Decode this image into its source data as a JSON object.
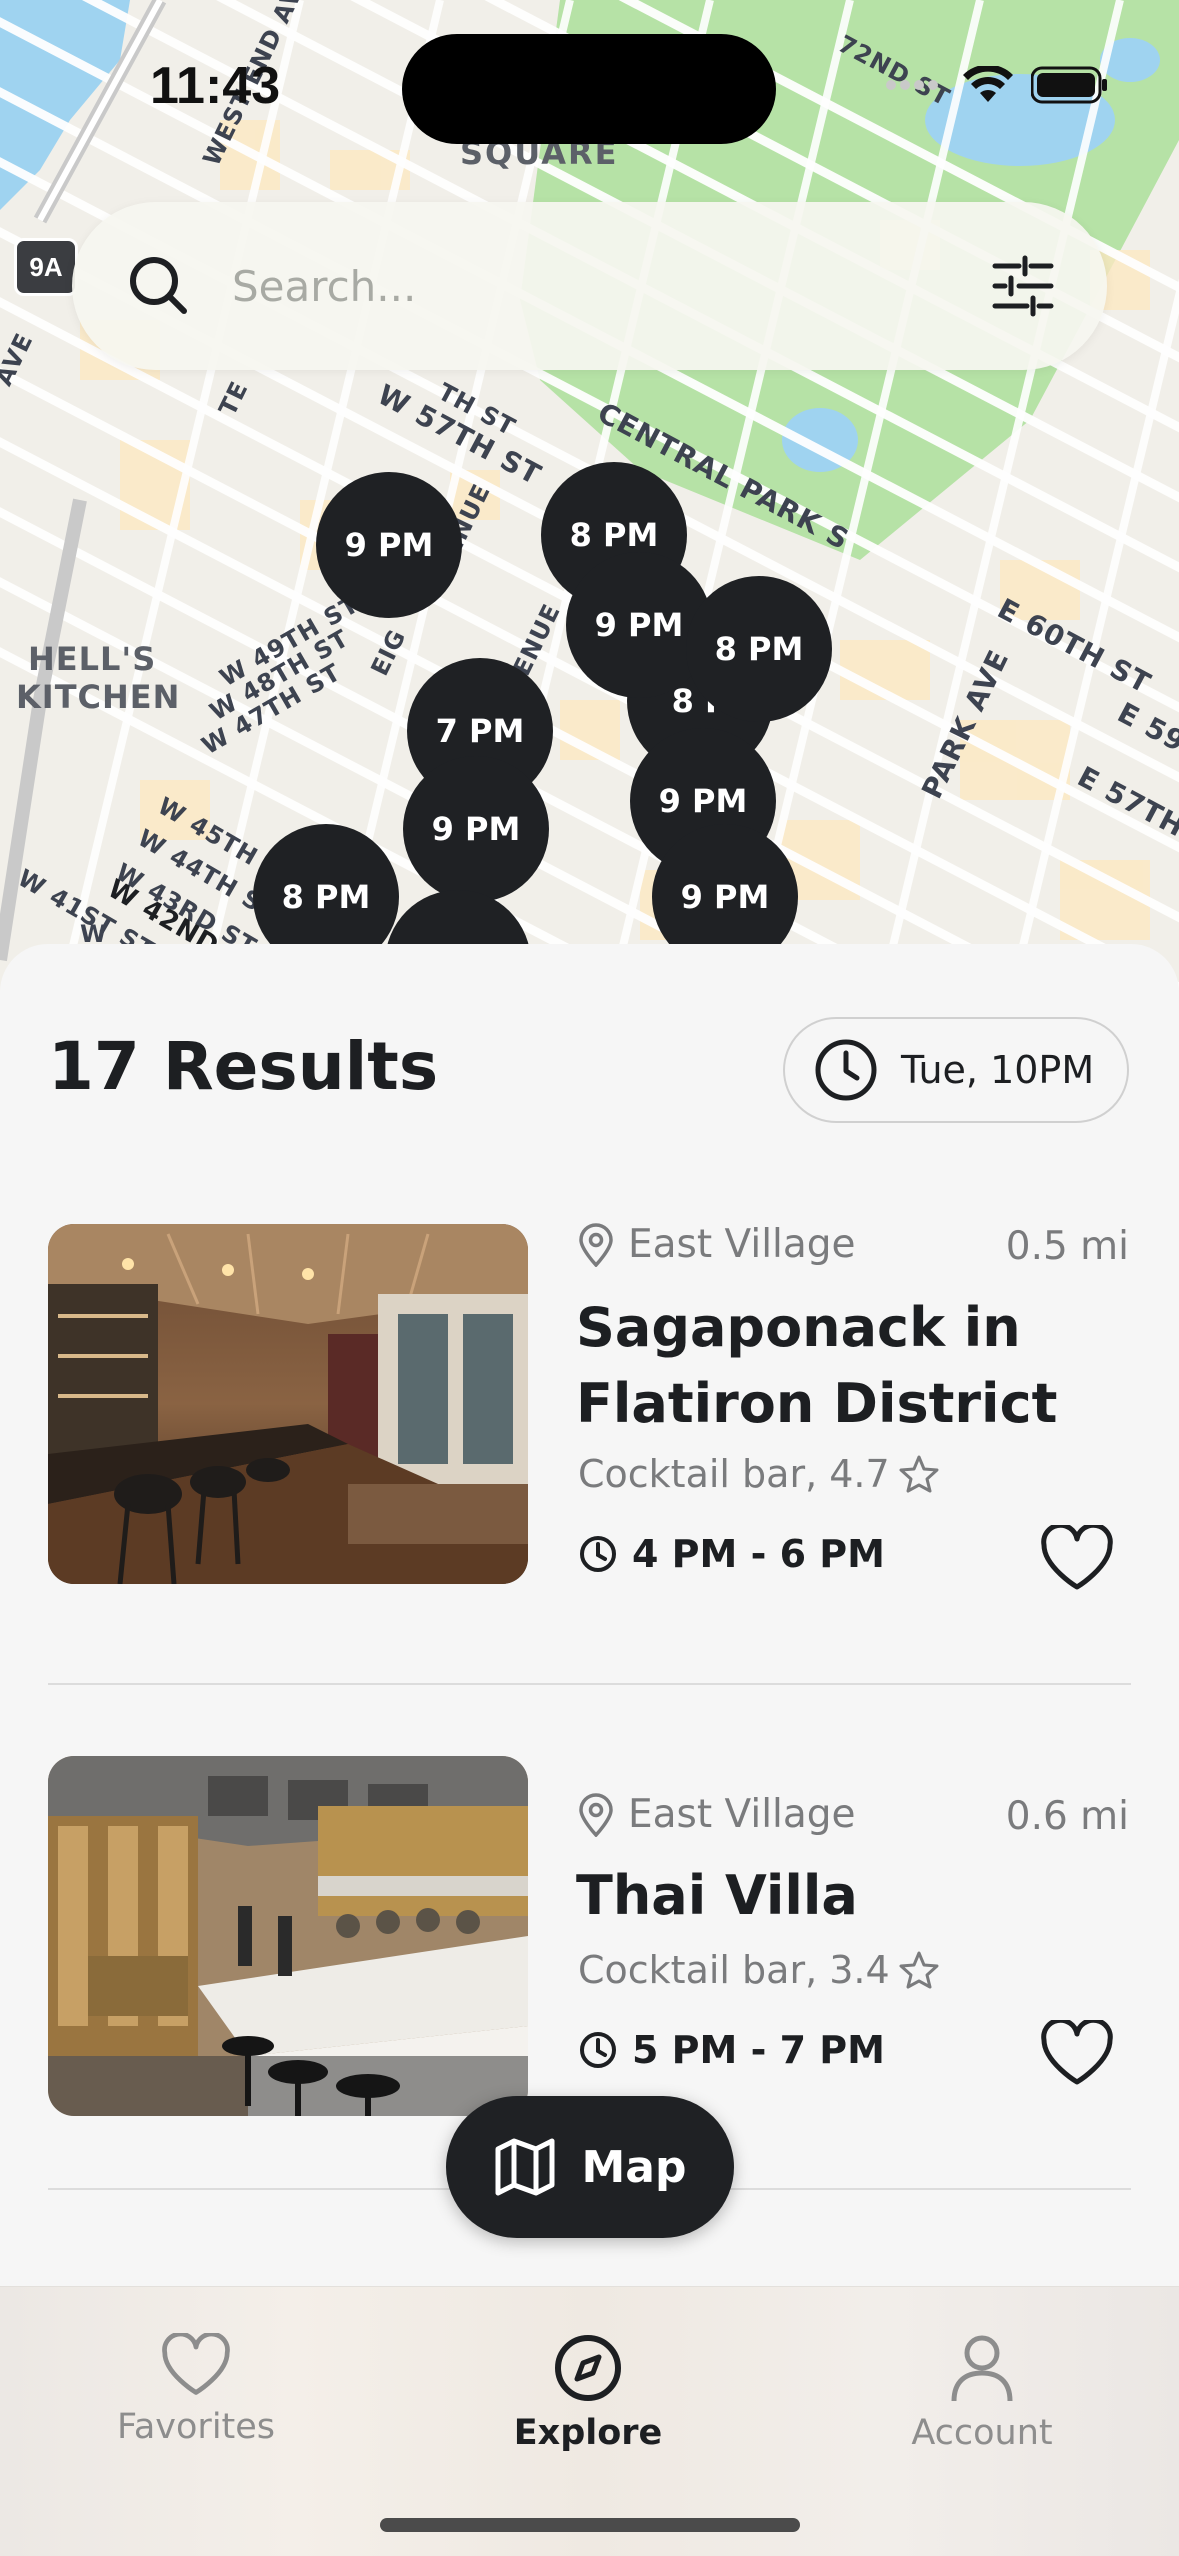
{
  "status_bar": {
    "time": "11:43"
  },
  "map": {
    "labels": {
      "square": "SQUARE",
      "hells_kitchen_1": "HELL'S",
      "hells_kitchen_2": "KITCHEN",
      "route": "9A"
    },
    "streets": {
      "w57": "W 57TH ST",
      "central_park_s": "CENTRAL PARK S",
      "e60": "E 60TH ST",
      "e59": "E 59",
      "e57": "E 57TH",
      "park_ave": "PARK AVE",
      "w49": "W 49TH ST",
      "w48": "W 48TH ST",
      "w47": "W 47TH ST",
      "w45": "W 45TH ST",
      "w44": "W 44TH ST",
      "w43": "W 43RD ST",
      "w42": "W 42ND ST",
      "w41": "W 41ST ST",
      "w_end": "W",
      "west_end_av": "WEST END AV",
      "seventy_second": "72ND ST",
      "ave_left": "AVE",
      "eighth_ave": "EIG",
      "enue_1": "ENUE",
      "enue_2": "ENUE",
      "te": "TE",
      "ith_st": "TH ST"
    },
    "pins": [
      {
        "label": "9 PM"
      },
      {
        "label": "8 PM"
      },
      {
        "label": "9 PM"
      },
      {
        "label": "8 PM"
      },
      {
        "label": "8 P"
      },
      {
        "label": "7 PM"
      },
      {
        "label": "9 PM"
      },
      {
        "label": "9 PM"
      },
      {
        "label": "8 PM"
      },
      {
        "label": "9 PM"
      },
      {
        "label": ""
      }
    ]
  },
  "search": {
    "placeholder": "Search..."
  },
  "results": {
    "title": "17 Results",
    "time_filter": "Tue, 10PM",
    "items": [
      {
        "neighborhood": "East Village",
        "distance": "0.5 mi",
        "name": "Sagaponack in Flatiron District",
        "category_rating": "Cocktail bar, 4.7",
        "hours": "4 PM - 6 PM"
      },
      {
        "neighborhood": "East Village",
        "distance": "0.6 mi",
        "name": "Thai Villa",
        "category_rating": "Cocktail bar, 3.4",
        "hours": "5 PM - 7 PM"
      }
    ]
  },
  "map_button": {
    "label": "Map"
  },
  "tabs": [
    {
      "label": "Favorites",
      "icon": "heart-icon",
      "active": false
    },
    {
      "label": "Explore",
      "icon": "compass-icon",
      "active": true
    },
    {
      "label": "Account",
      "icon": "person-icon",
      "active": false
    }
  ],
  "colors": {
    "pin": "#1f2124",
    "park": "#b6e2a6",
    "water": "#9fd3f0",
    "block": "#fde9c2",
    "accent": "#1d1f22"
  }
}
